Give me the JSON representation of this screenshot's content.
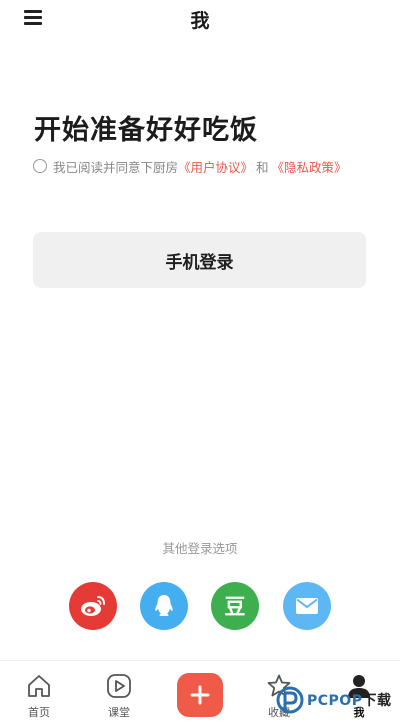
{
  "header": {
    "title": "我"
  },
  "main": {
    "headline": "开始准备好好吃饭",
    "agreement": {
      "prefix": "我已阅读并同意下厨房",
      "user_agreement": "《用户协议》",
      "conjunction": "和",
      "privacy_policy": "《隐私政策》"
    },
    "phone_login_label": "手机登录"
  },
  "other_login": {
    "title": "其他登录选项",
    "options": [
      {
        "icon": "weibo-icon",
        "color": "#e53a35"
      },
      {
        "icon": "qq-icon",
        "color": "#45aef0"
      },
      {
        "icon": "douban-icon",
        "label": "豆",
        "color": "#3eaf4f"
      },
      {
        "icon": "mail-icon",
        "color": "#5db7f2"
      }
    ]
  },
  "tabbar": {
    "items": [
      {
        "label": "首页",
        "icon": "home-icon"
      },
      {
        "label": "课堂",
        "icon": "play-icon"
      },
      {
        "label": "",
        "icon": "plus-icon"
      },
      {
        "label": "收藏",
        "icon": "star-icon"
      },
      {
        "label": "我",
        "icon": "user-icon",
        "active": true
      }
    ]
  },
  "watermark": {
    "brand": "PCPOP",
    "suffix": "下载"
  },
  "colors": {
    "accent": "#e8594a",
    "add_button": "#f05a48"
  }
}
